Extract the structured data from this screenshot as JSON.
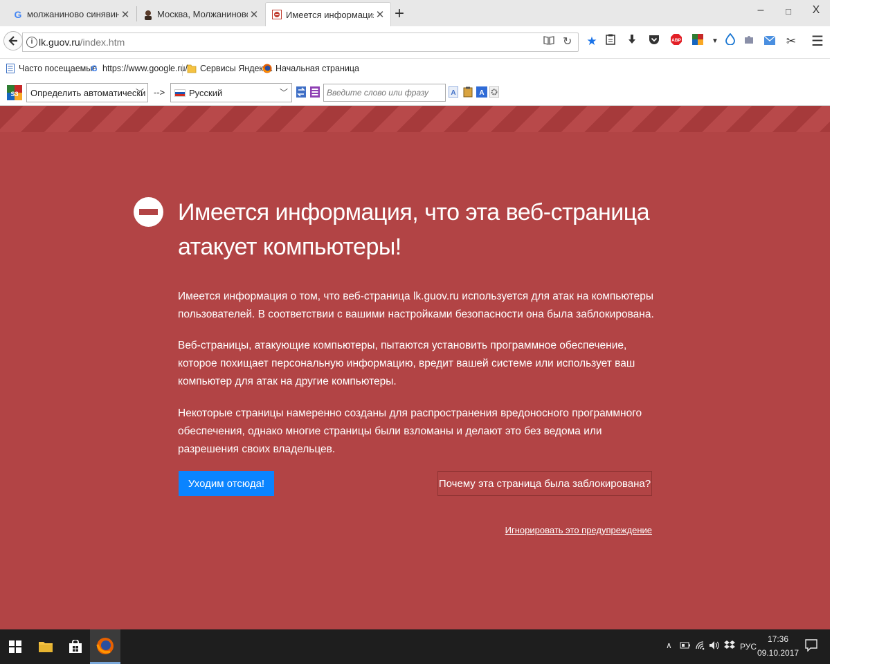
{
  "tabs": [
    {
      "title": "молжаниново синявинская",
      "favicon": "google-g-icon",
      "active": false
    },
    {
      "title": "Москва, Молжаниново, ул",
      "favicon": "avatar-icon",
      "active": false
    },
    {
      "title": "Имеется информация, что",
      "favicon": "warning-page-icon",
      "active": true
    }
  ],
  "window_controls": {
    "minimize": "–",
    "maximize": "□",
    "close": "X"
  },
  "nav": {
    "url_host": "lk.guov.ru",
    "url_path": "/index.htm"
  },
  "bookmarks": [
    {
      "label": "Часто посещаемые",
      "icon": "bookmark-page-icon"
    },
    {
      "label": "https://www.google.ru/",
      "icon": "google-g-icon"
    },
    {
      "label": "Сервисы Яндекса",
      "icon": "folder-icon"
    },
    {
      "label": "Начальная страница",
      "icon": "firefox-icon"
    }
  ],
  "translator": {
    "source_lang": "Определить автоматически",
    "arrow": "-->",
    "target_lang": "Русский",
    "input_placeholder": "Введите слово или фразу"
  },
  "content": {
    "title": "Имеется информация, что эта веб-страница атакует компьютеры!",
    "paragraphs": [
      "Имеется информация о том, что веб-страница lk.guov.ru используется для атак на компьютеры пользователей. В соответствии с вашими настройками безопасности она была заблокирована.",
      "Веб-страницы, атакующие компьютеры, пытаются установить программное обеспечение, которое похищает персональную информацию, вредит вашей системе или использует ваш компьютер для атак на другие компьютеры.",
      "Некоторые страницы намеренно созданы для распространения вредоносного программного обеспечения, однако многие страницы были взломаны и делают это без ведома или разрешения своих владельцев."
    ],
    "leave_button": "Уходим отсюда!",
    "why_button": "Почему эта страница была заблокирована?",
    "ignore_link": "Игнорировать это предупреждение"
  },
  "taskbar": {
    "lang": "РУС",
    "time": "17:36",
    "date": "09.10.2017"
  },
  "colors": {
    "page_bg": "#b24445",
    "stripe_dark": "#a63a3b",
    "button_blue": "#0a84ff",
    "taskbar": "#1e1e1e"
  }
}
